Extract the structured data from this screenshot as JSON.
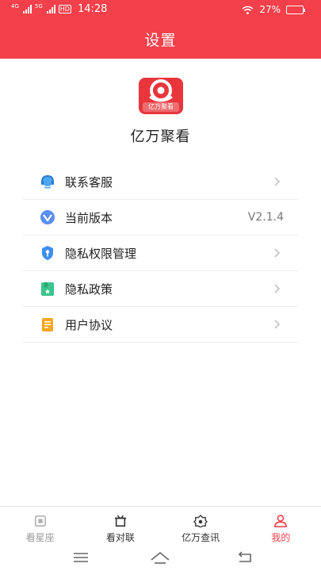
{
  "status_bar": {
    "network_1": "4G",
    "network_2": "5G",
    "hd": "HD",
    "time": "14:28",
    "battery": "27%",
    "battery_level": 0.27
  },
  "header": {
    "title": "设置"
  },
  "app": {
    "logo_text": "亿万聚看",
    "name": "亿万聚看"
  },
  "menu": {
    "items": [
      {
        "label": "联系客服",
        "icon": "customer-service-icon",
        "value": ""
      },
      {
        "label": "当前版本",
        "icon": "version-icon",
        "value": "V2.1.4"
      },
      {
        "label": "隐私权限管理",
        "icon": "privacy-shield-icon",
        "value": ""
      },
      {
        "label": "隐私政策",
        "icon": "privacy-policy-icon",
        "value": ""
      },
      {
        "label": "用户协议",
        "icon": "user-agreement-icon",
        "value": ""
      }
    ]
  },
  "tabbar": {
    "tabs": [
      {
        "label": "看星座",
        "icon": "horoscope-icon",
        "state": "inactive"
      },
      {
        "label": "看对联",
        "icon": "couplet-icon",
        "state": "normal"
      },
      {
        "label": "亿万查讯",
        "icon": "query-icon",
        "state": "normal"
      },
      {
        "label": "我的",
        "icon": "profile-icon",
        "state": "active"
      }
    ]
  },
  "colors": {
    "accent": "#f4404a",
    "text": "#222222",
    "muted": "#9a9a9a",
    "divider": "#eeeeee"
  },
  "system_nav": {
    "buttons": [
      "menu-icon",
      "home-icon",
      "back-icon"
    ]
  }
}
